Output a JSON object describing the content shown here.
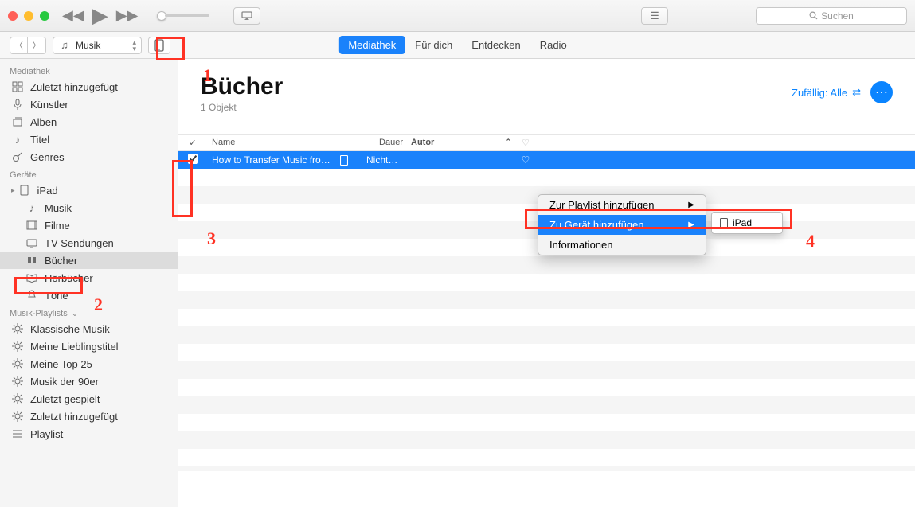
{
  "search_placeholder": "Suchen",
  "media_selector": "Musik",
  "top_tabs": [
    "Mediathek",
    "Für dich",
    "Entdecken",
    "Radio"
  ],
  "active_tab_index": 0,
  "sidebar": {
    "groups": [
      {
        "header": "Mediathek",
        "items": [
          {
            "icon": "grid",
            "label": "Zuletzt hinzugefügt"
          },
          {
            "icon": "mic",
            "label": "Künstler"
          },
          {
            "icon": "stack",
            "label": "Alben"
          },
          {
            "icon": "note",
            "label": "Titel"
          },
          {
            "icon": "guitar",
            "label": "Genres"
          }
        ]
      },
      {
        "header": "Geräte",
        "items": [
          {
            "icon": "ipad",
            "label": "iPad",
            "caret": true
          },
          {
            "icon": "note",
            "label": "Musik",
            "indent": true
          },
          {
            "icon": "film",
            "label": "Filme",
            "indent": true
          },
          {
            "icon": "tv",
            "label": "TV-Sendungen",
            "indent": true
          },
          {
            "icon": "book",
            "label": "Bücher",
            "indent": true,
            "selected": true
          },
          {
            "icon": "openbook",
            "label": "Hörbücher",
            "indent": true
          },
          {
            "icon": "bell",
            "label": "Töne",
            "indent": true
          }
        ]
      },
      {
        "header": "Musik-Playlists",
        "caret": true,
        "items": [
          {
            "icon": "gear",
            "label": "Klassische Musik"
          },
          {
            "icon": "gear",
            "label": "Meine Lieblingstitel"
          },
          {
            "icon": "gear",
            "label": "Meine Top 25"
          },
          {
            "icon": "gear",
            "label": "Musik der 90er"
          },
          {
            "icon": "gear",
            "label": "Zuletzt gespielt"
          },
          {
            "icon": "gear",
            "label": "Zuletzt hinzugefügt"
          },
          {
            "icon": "list",
            "label": "Playlist"
          }
        ]
      }
    ]
  },
  "page": {
    "title": "Bücher",
    "subtitle": "1 Objekt",
    "shuffle_label": "Zufällig: Alle"
  },
  "columns": {
    "name": "Name",
    "dauer": "Dauer",
    "autor": "Autor"
  },
  "row": {
    "title": "How to Transfer Music fro…",
    "dauer": "Nicht…"
  },
  "context_menu": {
    "items": [
      {
        "label": "Zur Playlist hinzufügen",
        "submenu": true
      },
      {
        "label": "Zu Gerät hinzufügen",
        "submenu": true,
        "highlight": true
      },
      {
        "label": "Informationen"
      }
    ],
    "submenu_item": "iPad"
  },
  "annotations": {
    "a1": "1",
    "a2": "2",
    "a3": "3",
    "a4": "4"
  }
}
